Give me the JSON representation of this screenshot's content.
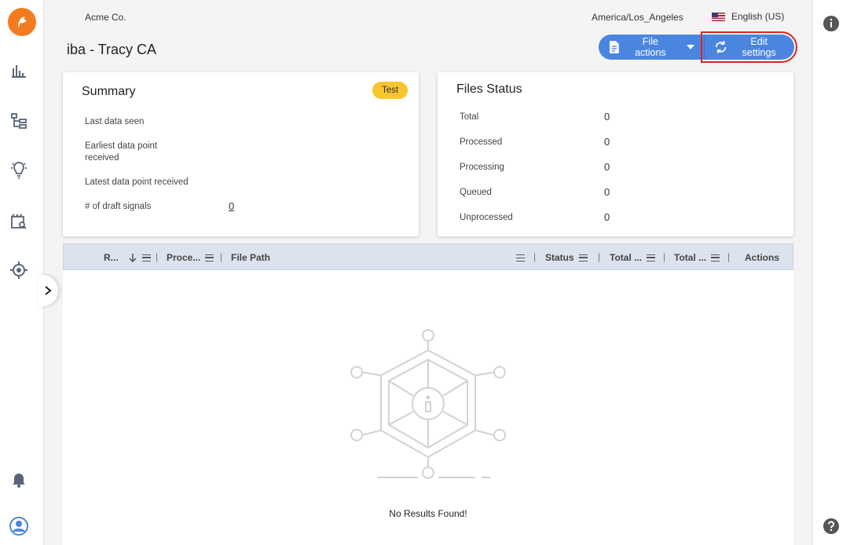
{
  "header": {
    "company": "Acme Co.",
    "timezone": "America/Los_Angeles",
    "language": "English (US)",
    "title": "iba - Tracy CA",
    "file_actions_label": "File actions",
    "edit_settings_label": "Edit settings"
  },
  "summary": {
    "title": "Summary",
    "badge": "Test",
    "rows": [
      {
        "label": "Last data seen",
        "value": ""
      },
      {
        "label": "Earliest data point received",
        "value": ""
      },
      {
        "label": "Latest data point received",
        "value": ""
      },
      {
        "label": "# of draft signals",
        "value": "0"
      }
    ]
  },
  "files_status": {
    "title": "Files Status",
    "rows": [
      {
        "label": "Total",
        "value": "0"
      },
      {
        "label": "Processed",
        "value": "0"
      },
      {
        "label": "Processing",
        "value": "0"
      },
      {
        "label": "Queued",
        "value": "0"
      },
      {
        "label": "Unprocessed",
        "value": "0"
      }
    ]
  },
  "table": {
    "columns": [
      "R...",
      "Proce...",
      "File Path",
      "Status",
      "Total ...",
      "Total ...",
      "Actions"
    ],
    "empty_message": "No Results Found!"
  },
  "colors": {
    "accent": "#4a86e0",
    "badge": "#f7c52e",
    "brand": "#f47b20",
    "highlight": "#e0241b"
  }
}
